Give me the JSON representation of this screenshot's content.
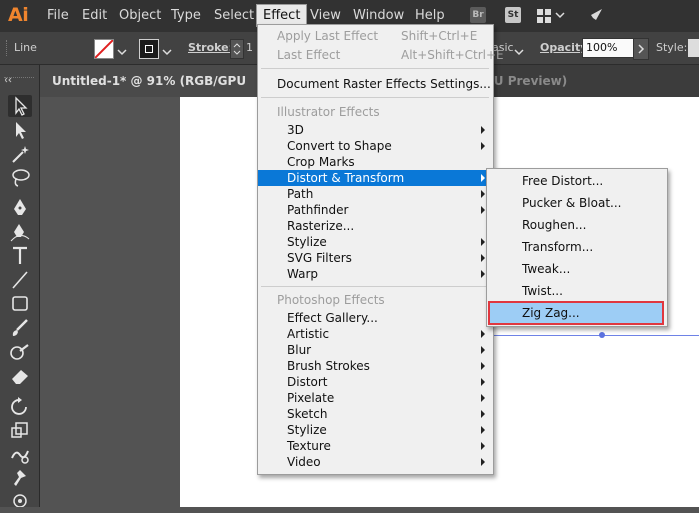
{
  "app": {
    "logo": "Ai"
  },
  "menubar": {
    "items": [
      "File",
      "Edit",
      "Object",
      "Type",
      "Select",
      "Effect",
      "View",
      "Window",
      "Help"
    ],
    "bridge": "Br",
    "stock": "St"
  },
  "control": {
    "selection": "Line",
    "stroke_label": "Stroke:",
    "stroke_value": "1",
    "style_fragment": "asic",
    "opacity_label": "Opacity:",
    "opacity_value": "100%",
    "style_label": "Style:"
  },
  "tabs": {
    "document": "Untitled-1* @ 91% (RGB/GPU Preview)",
    "second_partial": "PU Preview)"
  },
  "tools": [
    "selection-tool-icon",
    "direct-selection-tool-icon",
    "magic-wand-tool-icon",
    "lasso-tool-icon",
    "pen-tool-icon",
    "curvature-tool-icon",
    "type-tool-icon",
    "line-tool-icon",
    "rectangle-tool-icon",
    "paintbrush-tool-icon",
    "shaper-tool-icon",
    "eraser-tool-icon",
    "rotate-tool-icon",
    "scale-tool-icon",
    "warp-tool-icon",
    "puppet-warp-tool-icon",
    "free-transform-tool-icon"
  ],
  "effect_menu": {
    "apply_last": "Apply Last Effect",
    "apply_last_shortcut": "Shift+Ctrl+E",
    "last": "Last Effect",
    "last_shortcut": "Alt+Shift+Ctrl+E",
    "doc_raster": "Document Raster Effects Settings...",
    "illustrator_header": "Illustrator Effects",
    "illustrator_items": [
      "3D",
      "Convert to Shape",
      "Crop Marks",
      "Distort & Transform",
      "Path",
      "Pathfinder",
      "Rasterize...",
      "Stylize",
      "SVG Filters",
      "Warp"
    ],
    "photoshop_header": "Photoshop Effects",
    "photoshop_items": [
      "Effect Gallery...",
      "Artistic",
      "Blur",
      "Brush Strokes",
      "Distort",
      "Pixelate",
      "Sketch",
      "Stylize",
      "Texture",
      "Video"
    ]
  },
  "distort_submenu": {
    "items": [
      "Free Distort...",
      "Pucker & Bloat...",
      "Roughen...",
      "Transform...",
      "Tweak...",
      "Twist...",
      "Zig Zag..."
    ]
  },
  "colors": {
    "accent": "#0a78d7",
    "highlight_outline": "#e0373f",
    "submenu_highlight": "#9dcdf5"
  }
}
